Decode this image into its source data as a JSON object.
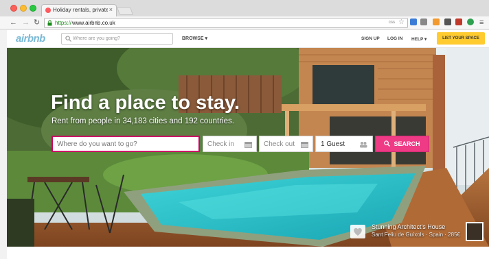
{
  "browser": {
    "tab_title": "Holiday rentals, private ro",
    "tab_close": "×",
    "url_scheme": "https://",
    "url_rest": "www.airbnb.co.uk",
    "omnibox_badge": "css"
  },
  "header": {
    "logo": "airbnb",
    "search_placeholder": "Where are you going?",
    "browse": "BROWSE ▾",
    "sign_up": "SIGN UP",
    "log_in": "LOG IN",
    "help": "HELP ▾",
    "list_space": "LIST YOUR SPACE"
  },
  "hero": {
    "title": "Find a place to stay.",
    "subtitle": "Rent from people in 34,183 cities and 192 countries.",
    "where_placeholder": "Where do you want to go?",
    "checkin_placeholder": "Check in",
    "checkout_placeholder": "Check out",
    "guests": "1 Guest",
    "search_button": "SEARCH",
    "caption_title": "Stunning Architect's House",
    "caption_location": "Sant Feliu de Guíxols · Spain · 285€"
  },
  "colors": {
    "brand_pink": "#ef3a86",
    "list_button": "#ffcb2f",
    "logo_blue": "#7ab9d6"
  }
}
